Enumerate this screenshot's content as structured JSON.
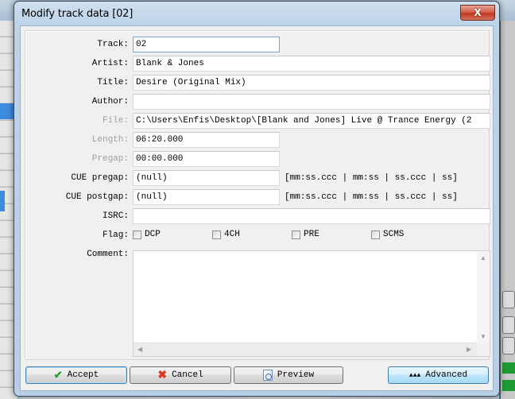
{
  "dialog": {
    "title": "Modify track data [02]",
    "close_label": "X"
  },
  "fields": {
    "track": {
      "label": "Track:",
      "value": "02"
    },
    "artist": {
      "label": "Artist:",
      "value": "Blank & Jones"
    },
    "title": {
      "label": "Title:",
      "value": "Desire (Original Mix)"
    },
    "author": {
      "label": "Author:",
      "value": ""
    },
    "file": {
      "label": "File:",
      "value": "C:\\Users\\Enfis\\Desktop\\[Blank and Jones] Live @ Trance Energy (2"
    },
    "length": {
      "label": "Length:",
      "value": "06:20.000"
    },
    "pregap": {
      "label": "Pregap:",
      "value": "00:00.000"
    },
    "cue_pregap": {
      "label": "CUE pregap:",
      "value": "(null)",
      "hint": "[mm:ss.ccc | mm:ss | ss.ccc | ss]"
    },
    "cue_postgap": {
      "label": "CUE postgap:",
      "value": "(null)",
      "hint": "[mm:ss.ccc | mm:ss | ss.ccc | ss]"
    },
    "isrc": {
      "label": "ISRC:",
      "value": ""
    },
    "flag": {
      "label": "Flag:",
      "options": [
        {
          "label": "DCP",
          "checked": false
        },
        {
          "label": "4CH",
          "checked": false
        },
        {
          "label": "PRE",
          "checked": false
        },
        {
          "label": "SCMS",
          "checked": false
        }
      ]
    },
    "comment": {
      "label": "Comment:",
      "value": ""
    }
  },
  "icons": {
    "scroll_up": "▲",
    "scroll_down": "▼",
    "scroll_left": "◀",
    "scroll_right": "▶",
    "accept": "✔",
    "cancel": "✖",
    "advanced": "▲▲▲"
  },
  "buttons": {
    "accept": "Accept",
    "cancel": "Cancel",
    "preview": "Preview",
    "advanced": "Advanced"
  }
}
